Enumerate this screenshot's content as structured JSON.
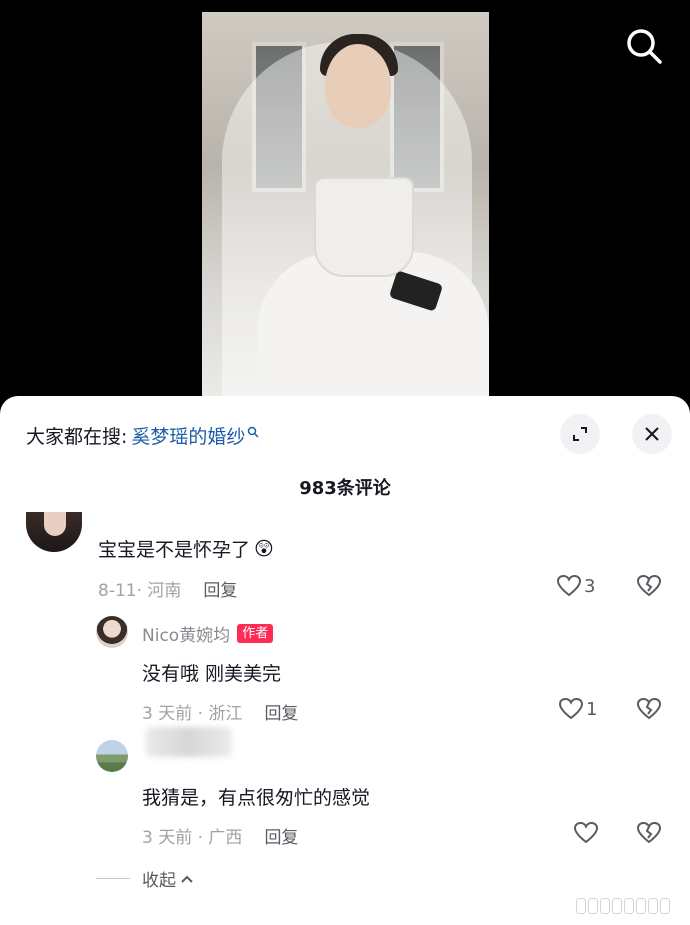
{
  "colors": {
    "keyword": "#1a5ca8",
    "author_tag": "#fe2c55",
    "meta": "#a1a2a7"
  },
  "video": {
    "icon": "search-icon"
  },
  "panel": {
    "search_prefix": "大家都在搜:",
    "search_keyword": "奚梦瑶的婚纱",
    "comment_count": "983条评论",
    "comments": [
      {
        "text": "宝宝是不是怀孕了",
        "emoji": "😲",
        "meta": "8-11· 河南",
        "reply": "回复",
        "likes": "3"
      },
      {
        "name": "Nico黄婉均",
        "tag": "作者",
        "text": "没有哦 刚美美完",
        "meta": "3 天前 · 浙江",
        "reply": "回复",
        "likes": "1"
      },
      {
        "text": "我猜是，有点很匆忙的感觉",
        "meta": "3 天前 · 广西",
        "reply": "回复",
        "likes": ""
      }
    ],
    "collapse": "收起"
  }
}
